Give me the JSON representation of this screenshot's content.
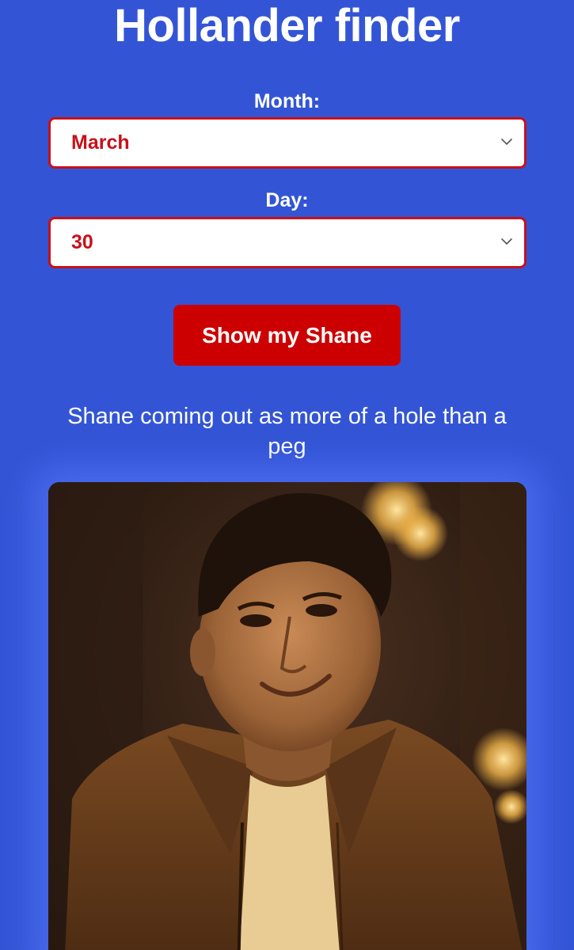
{
  "header": {
    "title": "Hollander finder"
  },
  "form": {
    "month_label": "Month:",
    "month_value": "March",
    "day_label": "Day:",
    "day_value": "30",
    "submit_label": "Show my Shane"
  },
  "result": {
    "caption": "Shane coming out as more of a hole than a peg",
    "image_icon": "person-photo"
  },
  "colors": {
    "background": "#3355d5",
    "accent_red": "#cc0000",
    "select_border": "#c8101a",
    "text": "#ffffff"
  }
}
